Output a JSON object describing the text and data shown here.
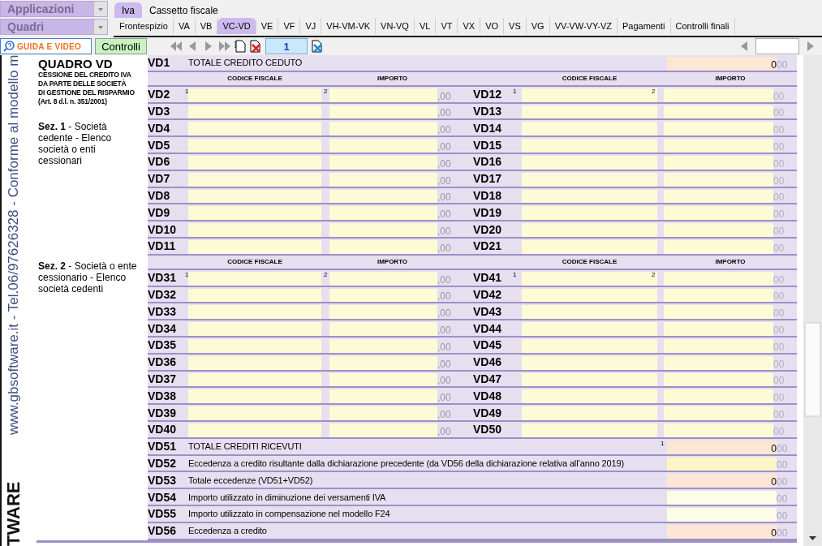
{
  "apps_menu": {
    "label": "Applicazioni"
  },
  "quadri_menu": {
    "label": "Quadri"
  },
  "top_tabs": [
    {
      "label": "Iva",
      "selected": true
    },
    {
      "label": "Cassetto fiscale",
      "selected": false
    }
  ],
  "section_tabs": [
    {
      "label": "Frontespizio",
      "selected": false
    },
    {
      "label": "VA",
      "selected": false
    },
    {
      "label": "VB",
      "selected": false
    },
    {
      "label": "VC-VD",
      "selected": true
    },
    {
      "label": "VE",
      "selected": false
    },
    {
      "label": "VF",
      "selected": false
    },
    {
      "label": "VJ",
      "selected": false
    },
    {
      "label": "VH-VM-VK",
      "selected": false
    },
    {
      "label": "VN-VQ",
      "selected": false
    },
    {
      "label": "VL",
      "selected": false
    },
    {
      "label": "VT",
      "selected": false
    },
    {
      "label": "VX",
      "selected": false
    },
    {
      "label": "VO",
      "selected": false
    },
    {
      "label": "VS",
      "selected": false
    },
    {
      "label": "VG",
      "selected": false
    },
    {
      "label": "VV-VW-VY-VZ",
      "selected": false
    },
    {
      "label": "Pagamenti",
      "selected": false
    },
    {
      "label": "Controlli finali",
      "selected": false
    }
  ],
  "toolbar": {
    "guide_button": "GUIDA E VIDEO",
    "check_button": "Controlli",
    "page": "1"
  },
  "side_banner": {
    "text": "www.gbsoftware.it - Tel.06/97626328 - Conforme al modello m",
    "brand": "TWARE"
  },
  "form": {
    "title": "QUADRO VD",
    "subtitle": [
      "CESSIONE DEL CREDITO IVA",
      "DA PARTE DELLE SOCIETÀ",
      "DI GESTIONE DEL RISPARMIO",
      "(Art. 8 d.l. n. 351/2001)"
    ],
    "credit_total": {
      "code": "VD1",
      "label": "TOTALE CREDITO CEDUTO",
      "value": "0",
      "cents": "00"
    },
    "sections": [
      {
        "title": "**Sez. 1** - Società cedente - Elenco società o enti cessionari",
        "headers": [
          "CODICE FISCALE",
          "IMPORTO",
          "CODICE FISCALE",
          "IMPORTO"
        ],
        "rows": [
          {
            "left": {
              "code": "VD2",
              "cf_note": "1",
              "amount_note": "2",
              "cents": ",00"
            },
            "right": {
              "code": "VD12",
              "cf_note": "1",
              "amount_note": "2",
              "cents": "00"
            }
          },
          {
            "left": {
              "code": "VD3",
              "cents": ",00"
            },
            "right": {
              "code": "VD13",
              "cents": "00"
            }
          },
          {
            "left": {
              "code": "VD4",
              "cents": ",00"
            },
            "right": {
              "code": "VD14",
              "cents": "00"
            }
          },
          {
            "left": {
              "code": "VD5",
              "cents": ",00"
            },
            "right": {
              "code": "VD15",
              "cents": "00"
            }
          },
          {
            "left": {
              "code": "VD6",
              "cents": ",00"
            },
            "right": {
              "code": "VD16",
              "cents": "00"
            }
          },
          {
            "left": {
              "code": "VD7",
              "cents": ",00"
            },
            "right": {
              "code": "VD17",
              "cents": "00"
            }
          },
          {
            "left": {
              "code": "VD8",
              "cents": ",00"
            },
            "right": {
              "code": "VD18",
              "cents": "00"
            }
          },
          {
            "left": {
              "code": "VD9",
              "cents": ",00"
            },
            "right": {
              "code": "VD19",
              "cents": "00"
            }
          },
          {
            "left": {
              "code": "VD10",
              "cents": ",00"
            },
            "right": {
              "code": "VD20",
              "cents": "00"
            }
          },
          {
            "left": {
              "code": "VD11",
              "cents": ",00"
            },
            "right": {
              "code": "VD21",
              "cents": "00"
            }
          }
        ]
      },
      {
        "title": "**Sez. 2** - Società o ente cessionario - Elenco società cedenti",
        "headers": [
          "CODICE FISCALE",
          "IMPORTO",
          "CODICE FISCALE",
          "IMPORTO"
        ],
        "rows": [
          {
            "left": {
              "code": "VD31",
              "cf_note": "1",
              "amount_note": "2",
              "cents": ",00"
            },
            "right": {
              "code": "VD41",
              "cf_note": "1",
              "amount_note": "2",
              "cents": "00"
            }
          },
          {
            "left": {
              "code": "VD32",
              "cents": ",00"
            },
            "right": {
              "code": "VD42",
              "cents": "00"
            }
          },
          {
            "left": {
              "code": "VD33",
              "cents": ",00"
            },
            "right": {
              "code": "VD43",
              "cents": "00"
            }
          },
          {
            "left": {
              "code": "VD34",
              "cents": ",00"
            },
            "right": {
              "code": "VD44",
              "cents": "00"
            }
          },
          {
            "left": {
              "code": "VD35",
              "cents": ",00"
            },
            "right": {
              "code": "VD45",
              "cents": "00"
            }
          },
          {
            "left": {
              "code": "VD36",
              "cents": ",00"
            },
            "right": {
              "code": "VD46",
              "cents": "00"
            }
          },
          {
            "left": {
              "code": "VD37",
              "cents": ",00"
            },
            "right": {
              "code": "VD47",
              "cents": "00"
            }
          },
          {
            "left": {
              "code": "VD38",
              "cents": ",00"
            },
            "right": {
              "code": "VD48",
              "cents": "00"
            }
          },
          {
            "left": {
              "code": "VD39",
              "cents": ",00"
            },
            "right": {
              "code": "VD49",
              "cents": "00"
            }
          },
          {
            "left": {
              "code": "VD40",
              "cents": ",00"
            },
            "right": {
              "code": "VD50",
              "cents": "00"
            }
          }
        ]
      }
    ],
    "totals": [
      {
        "code": "VD51",
        "label": "TOTALE CREDITI RICEVUTI",
        "note": "1",
        "kind": "calculated",
        "highlighted": false,
        "value": "0",
        "cents": "00"
      },
      {
        "code": "VD52",
        "label": "Eccedenza a credito risultante dalla dichiarazione precedente (da VD56 della dichiarazione relativa all’anno 2019)",
        "kind": "input",
        "highlighted": true,
        "cents": "00"
      },
      {
        "code": "VD53",
        "label": "Totale eccedenze (VD51+VD52)",
        "kind": "calculated",
        "highlighted": false,
        "value": "0",
        "cents": "00"
      },
      {
        "code": "VD54",
        "label": "Importo utilizzato in diminuzione dei versamenti IVA",
        "kind": "input",
        "highlighted": false,
        "cents": "00"
      },
      {
        "code": "VD55",
        "label": "Importo utilizzato in compensazione nel modello F24",
        "kind": "input",
        "highlighted": false,
        "cents": "00"
      },
      {
        "code": "VD56",
        "label": "Eccedenza a credito",
        "kind": "calculated",
        "highlighted": false,
        "value": "0",
        "cents": "00"
      }
    ]
  }
}
